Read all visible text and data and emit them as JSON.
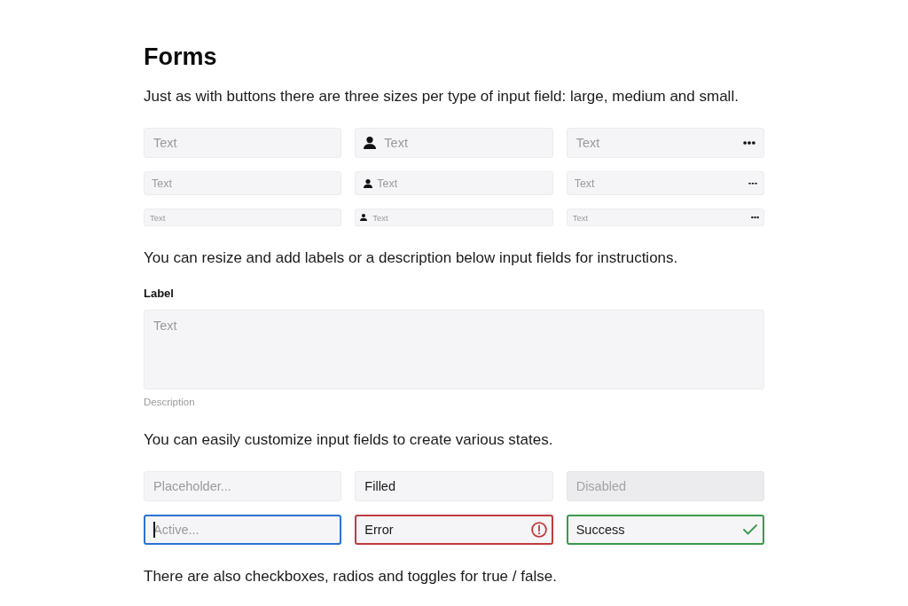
{
  "title": "Forms",
  "intro": "Just as with buttons there are three sizes per type of input field: large, medium and small.",
  "size_rows": [
    {
      "kind": "large",
      "fields": [
        {
          "kind": "plain",
          "placeholder": "Text"
        },
        {
          "kind": "leading-icon",
          "placeholder": "Text"
        },
        {
          "kind": "trailing-icon",
          "placeholder": "Text"
        }
      ]
    },
    {
      "kind": "medium",
      "fields": [
        {
          "kind": "plain",
          "placeholder": "Text"
        },
        {
          "kind": "leading-icon",
          "placeholder": "Text"
        },
        {
          "kind": "trailing-icon",
          "placeholder": "Text"
        }
      ]
    },
    {
      "kind": "small",
      "fields": [
        {
          "kind": "plain",
          "placeholder": "Text"
        },
        {
          "kind": "leading-icon",
          "placeholder": "Text"
        },
        {
          "kind": "trailing-icon",
          "placeholder": "Text"
        }
      ]
    }
  ],
  "resize_note": "You can resize and add labels or a description below input fields for instructions.",
  "labeled_field": {
    "label": "Label",
    "placeholder": "Text",
    "description": "Description"
  },
  "states_note": "You can easily customize input fields to create various states.",
  "state_fields": [
    {
      "kind": "placeholder",
      "placeholder": "Placeholder..."
    },
    {
      "kind": "filled",
      "value": "Filled"
    },
    {
      "kind": "disabled",
      "placeholder": "Disabled"
    },
    {
      "kind": "active",
      "placeholder": "Active..."
    },
    {
      "kind": "error",
      "value": "Error"
    },
    {
      "kind": "success",
      "value": "Success"
    }
  ],
  "outro": "There are also checkboxes, radios and toggles for true / false."
}
